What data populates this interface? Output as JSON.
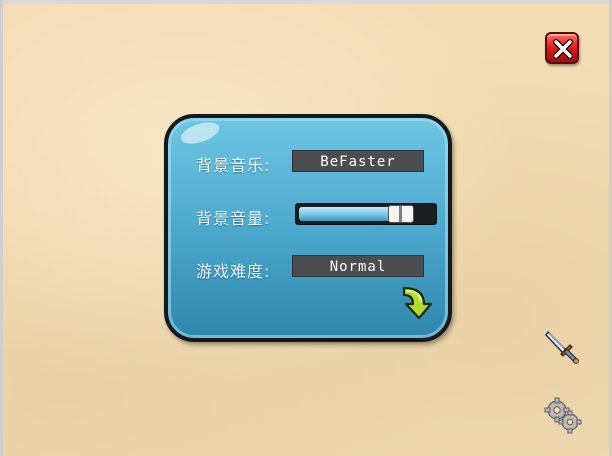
{
  "settings": {
    "music_label": "背景音乐:",
    "music_value": "BeFaster",
    "volume_label": "背景音量:",
    "volume_level": 0.82,
    "difficulty_label": "游戏难度:",
    "difficulty_value": "Normal"
  },
  "icons": {
    "close": "close-x-icon",
    "next": "curved-arrow-down-icon",
    "sword": "sword-icon",
    "gears": "gears-icon"
  },
  "colors": {
    "panel": "#49a6cb",
    "close_button": "#d8151a",
    "arrow": "#b5d930",
    "background": "#f1dcb4"
  }
}
